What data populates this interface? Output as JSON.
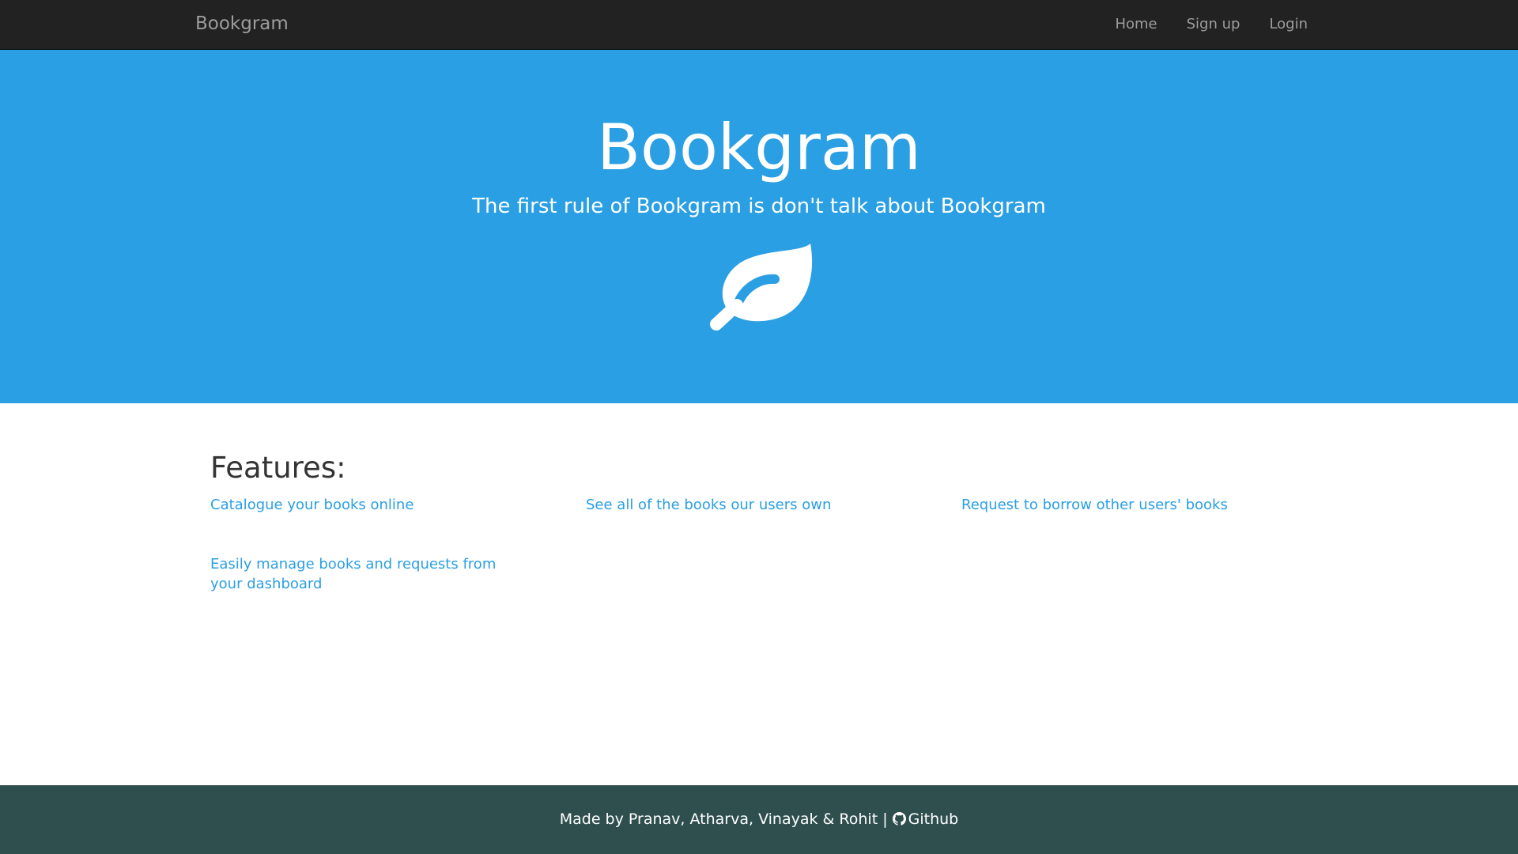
{
  "navbar": {
    "brand": "Bookgram",
    "links": [
      {
        "label": "Home"
      },
      {
        "label": "Sign up"
      },
      {
        "label": "Login"
      }
    ]
  },
  "hero": {
    "title": "Bookgram",
    "tagline": "The first rule of Bookgram is don't talk about Bookgram",
    "icon": "leaf-icon"
  },
  "features": {
    "heading": "Features:",
    "items": [
      {
        "label": "Catalogue your books online"
      },
      {
        "label": "See all of the books our users own"
      },
      {
        "label": "Request to borrow other users' books"
      },
      {
        "label": "Easily manage books and requests from your dashboard"
      }
    ]
  },
  "footer": {
    "credit": "Made by Pranav, Atharva, Vinayak & Rohit",
    "separator": "|",
    "github_label": "Github",
    "github_icon": "github-icon"
  },
  "colors": {
    "navbar_bg": "#222222",
    "hero_bg": "#2b9fe3",
    "link": "#2b9fe3",
    "footer_bg": "#2f4f4f"
  }
}
